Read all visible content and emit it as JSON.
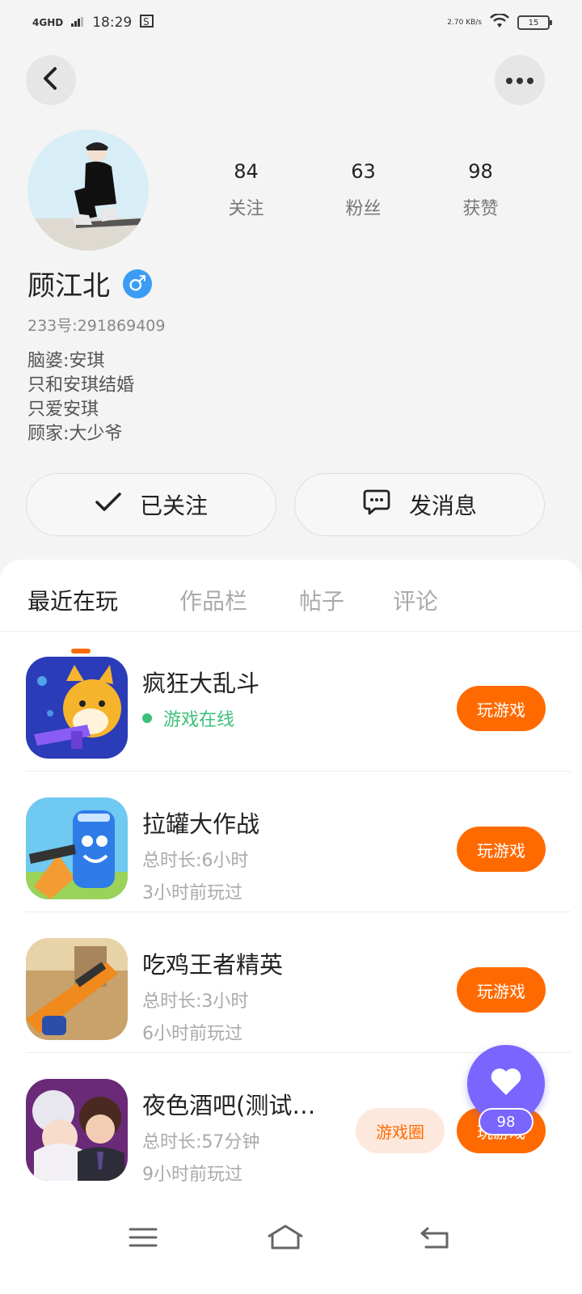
{
  "status_bar": {
    "network": "4GHD",
    "time": "18:29",
    "speed": "2.70 KB/s",
    "battery": "15"
  },
  "profile": {
    "stats": [
      {
        "value": "84",
        "label": "关注"
      },
      {
        "value": "63",
        "label": "粉丝"
      },
      {
        "value": "98",
        "label": "获赞"
      }
    ],
    "name": "顾江北",
    "gender_symbol": "♂",
    "uid": "233号:291869409",
    "bio": [
      "脑婆:安琪",
      "只和安琪结婚",
      "只爱安琪",
      "顾家:大少爷"
    ]
  },
  "actions": {
    "follow_label": "已关注",
    "message_label": "发消息"
  },
  "tabs": [
    {
      "label": "最近在玩",
      "active": true
    },
    {
      "label": "作品栏",
      "active": false
    },
    {
      "label": "帖子",
      "active": false
    },
    {
      "label": "评论",
      "active": false
    }
  ],
  "games": [
    {
      "name": "疯狂大乱斗",
      "line1": "游戏在线",
      "line2": "",
      "button": "玩游戏"
    },
    {
      "name": "拉罐大作战",
      "line1": "总时长:6小时",
      "line2": "3小时前玩过",
      "button": "玩游戏"
    },
    {
      "name": "吃鸡王者精英",
      "line1": "总时长:3小时",
      "line2": "6小时前玩过",
      "button": "玩游戏"
    },
    {
      "name": "夜色酒吧(测试…",
      "line1": "总时长:57分钟",
      "line2": "9小时前玩过",
      "button": "玩游戏",
      "secondary_button": "游戏圈"
    }
  ],
  "like_fab": {
    "count": "98"
  },
  "colors": {
    "accent": "#ff6a00",
    "online": "#3cc07a",
    "fab": "#7a65ff",
    "gender": "#3b9cf5"
  }
}
